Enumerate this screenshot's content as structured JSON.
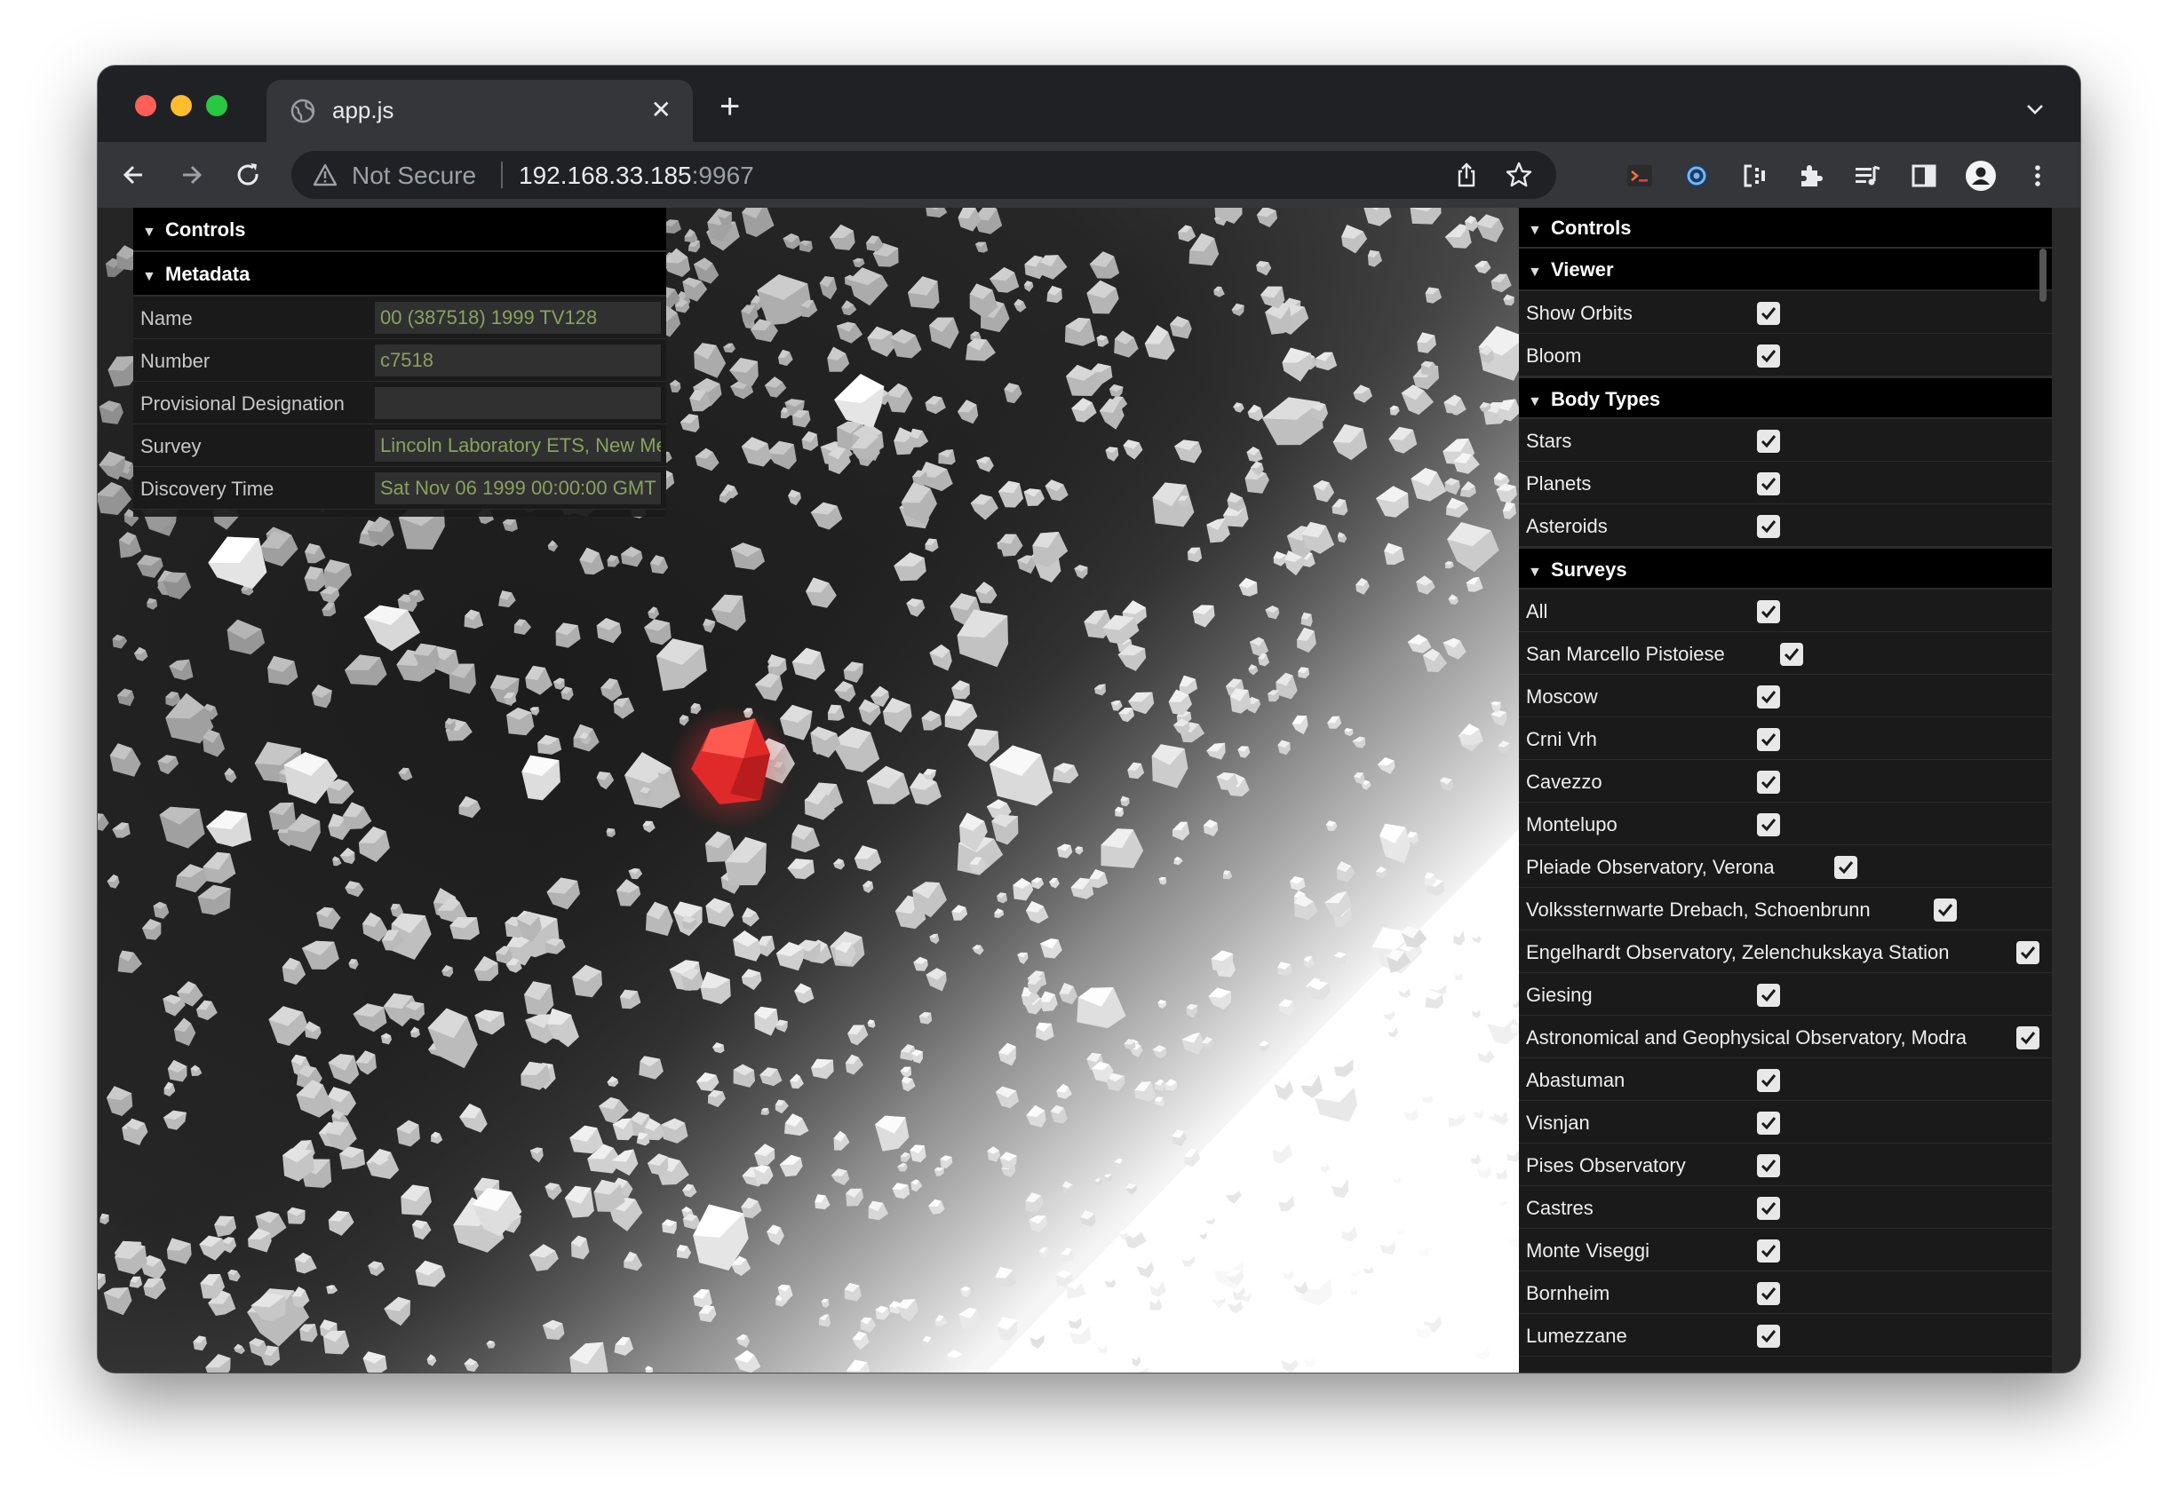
{
  "tab": {
    "title": "app.js"
  },
  "omnibox": {
    "security_label": "Not Secure",
    "host": "192.168.33.185",
    "port": ":9967"
  },
  "left_panel": {
    "controls_title": "Controls",
    "metadata_title": "Metadata",
    "rows": [
      {
        "label": "Name",
        "value": "00 (387518) 1999 TV128"
      },
      {
        "label": "Number",
        "value": "c7518"
      },
      {
        "label": "Provisional Designation",
        "value": ""
      },
      {
        "label": "Survey",
        "value": "Lincoln Laboratory ETS, New Mexico"
      },
      {
        "label": "Discovery Time",
        "value": "Sat Nov 06 1999 00:00:00 GMT"
      }
    ]
  },
  "right_panel": {
    "controls_title": "Controls",
    "viewer": {
      "title": "Viewer",
      "items": [
        {
          "label": "Show Orbits",
          "checked": true
        },
        {
          "label": "Bloom",
          "checked": true
        }
      ]
    },
    "body_types": {
      "title": "Body Types",
      "items": [
        {
          "label": "Stars",
          "checked": true
        },
        {
          "label": "Planets",
          "checked": true
        },
        {
          "label": "Asteroids",
          "checked": true
        }
      ]
    },
    "surveys": {
      "title": "Surveys",
      "items": [
        {
          "label": "All",
          "checked": true
        },
        {
          "label": "San Marcello Pistoiese",
          "checked": true
        },
        {
          "label": "Moscow",
          "checked": true
        },
        {
          "label": "Crni Vrh",
          "checked": true
        },
        {
          "label": "Cavezzo",
          "checked": true
        },
        {
          "label": "Montelupo",
          "checked": true
        },
        {
          "label": "Pleiade Observatory, Verona",
          "checked": true
        },
        {
          "label": "Volkssternwarte Drebach, Schoenbrunn",
          "checked": true
        },
        {
          "label": "Engelhardt Observatory, Zelenchukskaya Station",
          "checked": true
        },
        {
          "label": "Giesing",
          "checked": true
        },
        {
          "label": "Astronomical and Geophysical Observatory, Modra",
          "checked": true
        },
        {
          "label": "Abastuman",
          "checked": true
        },
        {
          "label": "Visnjan",
          "checked": true
        },
        {
          "label": "Pises Observatory",
          "checked": true
        },
        {
          "label": "Castres",
          "checked": true
        },
        {
          "label": "Monte Viseggi",
          "checked": true
        },
        {
          "label": "Bornheim",
          "checked": true
        },
        {
          "label": "Lumezzane",
          "checked": true
        }
      ]
    }
  },
  "colors": {
    "selected_asteroid": "#e02a2a",
    "asteroid": "#d8d8d8",
    "gui_background": "#1a1a1a",
    "gui_value_text": "#8aa15f"
  }
}
